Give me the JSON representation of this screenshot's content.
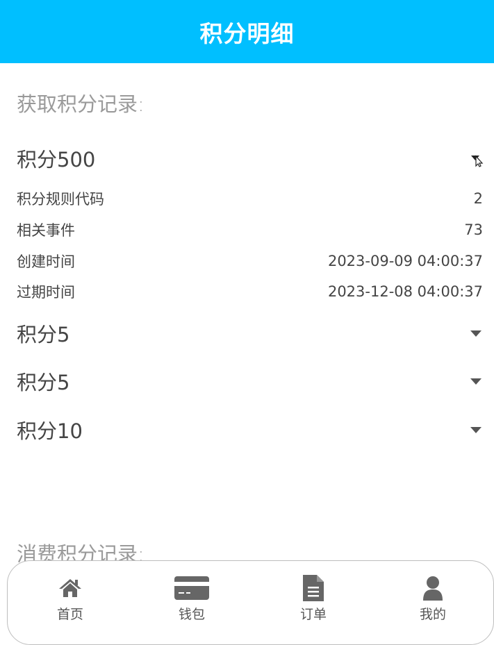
{
  "header": {
    "title": "积分明细"
  },
  "earn_section": {
    "title": "获取积分记录:",
    "records": [
      {
        "label": "积分500",
        "expanded": true,
        "details": [
          {
            "key": "积分规则代码",
            "value": "2"
          },
          {
            "key": "相关事件",
            "value": "73"
          },
          {
            "key": "创建时间",
            "value": "2023-09-09 04:00:37"
          },
          {
            "key": "过期时间",
            "value": "2023-12-08 04:00:37"
          }
        ]
      },
      {
        "label": "积分5",
        "expanded": false
      },
      {
        "label": "积分5",
        "expanded": false
      },
      {
        "label": "积分10",
        "expanded": false
      }
    ]
  },
  "spend_section": {
    "title": "消费积分记录:"
  },
  "tabbar": {
    "items": [
      {
        "label": "首页",
        "icon": "home-icon"
      },
      {
        "label": "钱包",
        "icon": "wallet-icon"
      },
      {
        "label": "订单",
        "icon": "document-icon"
      },
      {
        "label": "我的",
        "icon": "user-icon"
      }
    ]
  },
  "colors": {
    "header_bg": "#00bfff",
    "icon_gray": "#666666"
  }
}
